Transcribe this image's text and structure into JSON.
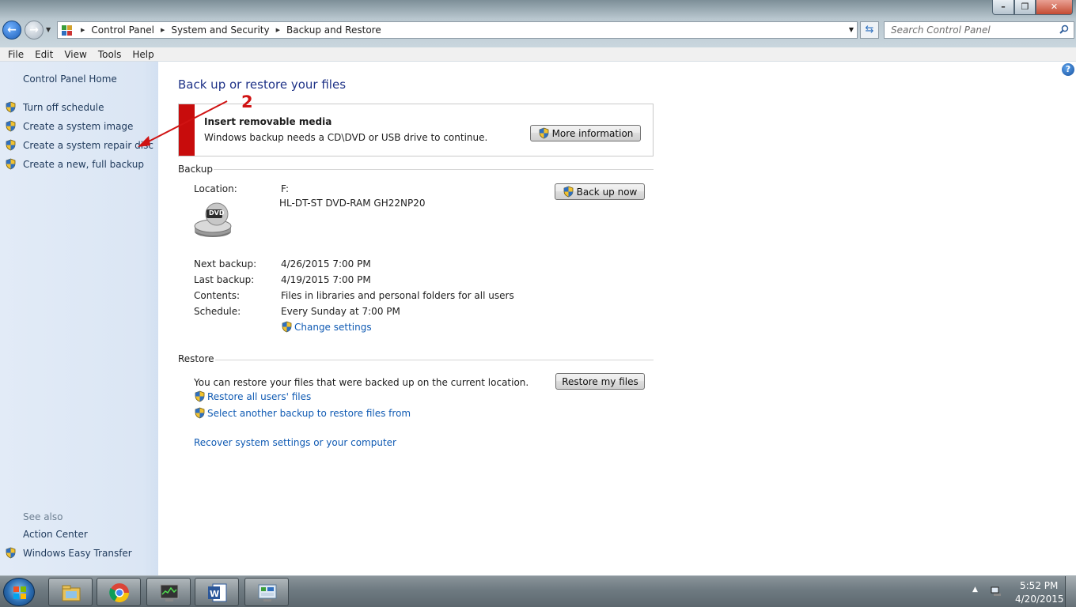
{
  "address_bar": {
    "crumbs": [
      "Control Panel",
      "System and Security",
      "Backup and Restore"
    ]
  },
  "search": {
    "placeholder": "Search Control Panel"
  },
  "menu": [
    "File",
    "Edit",
    "View",
    "Tools",
    "Help"
  ],
  "sidebar": {
    "home": "Control Panel Home",
    "tasks": [
      "Turn off schedule",
      "Create a system image",
      "Create a system repair disc",
      "Create a new, full backup"
    ],
    "see_also_label": "See also",
    "see_also": [
      "Action Center",
      "Windows Easy Transfer"
    ]
  },
  "main": {
    "title": "Back up or restore your files",
    "notice": {
      "title": "Insert removable media",
      "text": "Windows backup needs a CD\\DVD or USB drive to continue.",
      "button": "More information"
    },
    "backup": {
      "heading": "Backup",
      "location_label": "Location:",
      "location_drive": "F:",
      "location_device": "HL-DT-ST DVD-RAM GH22NP20",
      "dvd_icon_text": "DVD",
      "backup_now": "Back up now",
      "next_label": "Next backup:",
      "next_value": "4/26/2015 7:00 PM",
      "last_label": "Last backup:",
      "last_value": "4/19/2015 7:00 PM",
      "contents_label": "Contents:",
      "contents_value": "Files in libraries and personal folders for all users",
      "schedule_label": "Schedule:",
      "schedule_value": "Every Sunday at 7:00 PM",
      "change_settings": "Change settings"
    },
    "restore": {
      "heading": "Restore",
      "text": "You can restore your files that were backed up on the current location.",
      "button": "Restore my files",
      "all_users": "Restore all users' files",
      "select_another": "Select another backup to restore files from",
      "recover": "Recover system settings or your computer"
    }
  },
  "annotation": {
    "number": "2",
    "color": "#d01313"
  },
  "taskbar": {
    "time": "5:52 PM",
    "date": "4/20/2015",
    "pinned": [
      "windows-explorer-icon",
      "chrome-icon",
      "task-manager-icon",
      "word-icon",
      "control-panel-icon"
    ]
  },
  "colors": {
    "link": "#0f5ab3",
    "sidebar_bg": "#dbe6f4",
    "title": "#1e3287",
    "alert": "#c80c0c"
  }
}
